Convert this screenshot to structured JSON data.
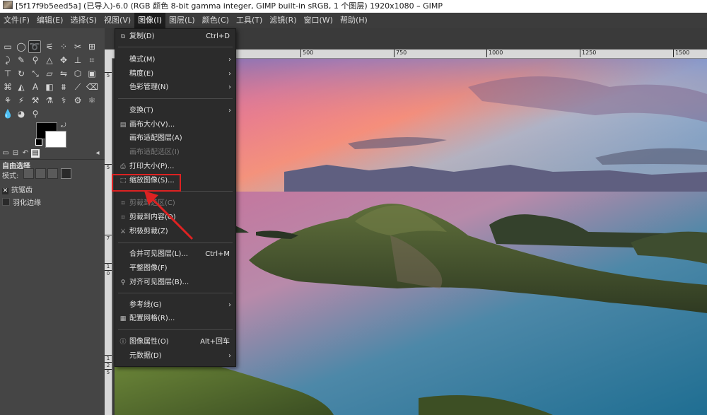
{
  "window": {
    "title": "[5f17f9b5eed5a] (已导入)-6.0 (RGB 颜色 8-bit gamma integer, GIMP built-in sRGB, 1 个图层) 1920x1080 – GIMP"
  },
  "menubar": [
    {
      "label": "文件(F)"
    },
    {
      "label": "编辑(E)"
    },
    {
      "label": "选择(S)"
    },
    {
      "label": "视图(V)"
    },
    {
      "label": "图像(I)",
      "active": true
    },
    {
      "label": "图层(L)"
    },
    {
      "label": "颜色(C)"
    },
    {
      "label": "工具(T)"
    },
    {
      "label": "滤镜(R)"
    },
    {
      "label": "窗口(W)"
    },
    {
      "label": "帮助(H)"
    }
  ],
  "toolbox": {
    "tool_options_title": "自由选择",
    "mode_label": "模式:",
    "antialias_label": "抗锯齿",
    "feather_label": "羽化边缘",
    "fg_color": "#000000",
    "bg_color": "#ffffff"
  },
  "ruler": {
    "h_ticks": [
      "500",
      "750",
      "1000",
      "1250",
      "1500"
    ],
    "v_ticks": [
      "5",
      "5",
      "7",
      "1",
      "0",
      "1",
      "2",
      "5"
    ]
  },
  "image_menu": {
    "items": [
      {
        "icon": "duplicate-icon",
        "label": "复制(D)",
        "shortcut": "Ctrl+D"
      },
      {
        "label": "模式(M)",
        "submenu": true
      },
      {
        "label": "精度(E)",
        "submenu": true
      },
      {
        "label": "色彩管理(N)",
        "submenu": true
      },
      {
        "label": "变换(T)",
        "submenu": true
      },
      {
        "icon": "canvas-size-icon",
        "label": "画布大小(V)..."
      },
      {
        "label": "画布适配图层(A)"
      },
      {
        "label": "画布适配选区(I)",
        "disabled": true
      },
      {
        "icon": "print-size-icon",
        "label": "打印大小(P)..."
      },
      {
        "icon": "scale-image-icon",
        "label": "缩放图像(S)...",
        "highlighted": true
      },
      {
        "icon": "crop-icon",
        "label": "剪裁到选区(C)",
        "disabled": true
      },
      {
        "icon": "crop-content-icon",
        "label": "剪裁到内容(O)"
      },
      {
        "icon": "zealous-crop-icon",
        "label": "积极剪裁(Z)"
      },
      {
        "label": "合并可见图层(L)...",
        "shortcut": "Ctrl+M"
      },
      {
        "label": "平整图像(F)"
      },
      {
        "icon": "align-icon",
        "label": "对齐可见图层(B)..."
      },
      {
        "label": "参考线(G)",
        "submenu": true
      },
      {
        "icon": "grid-icon",
        "label": "配置网格(R)..."
      },
      {
        "icon": "info-icon",
        "label": "图像属性(O)",
        "shortcut": "Alt+回车"
      },
      {
        "label": "元数据(D)",
        "submenu": true
      }
    ]
  },
  "annotation": {
    "color": "#d22222"
  }
}
